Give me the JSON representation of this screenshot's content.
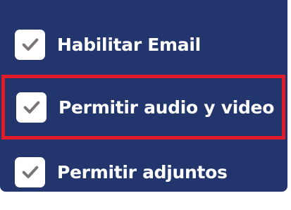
{
  "options": [
    {
      "label": "Habilitar Email",
      "checked": true
    },
    {
      "label": "Permitir audio y video",
      "checked": true,
      "highlighted": true
    },
    {
      "label": "Permitir adjuntos",
      "checked": true
    }
  ],
  "colors": {
    "panel_background": "#22356c",
    "highlight_border": "#e01c2b",
    "checkbox_background": "#ffffff",
    "checkmark": "#7a7574",
    "label_text": "#ffffff"
  },
  "icons": {
    "check": "checkmark-icon"
  }
}
